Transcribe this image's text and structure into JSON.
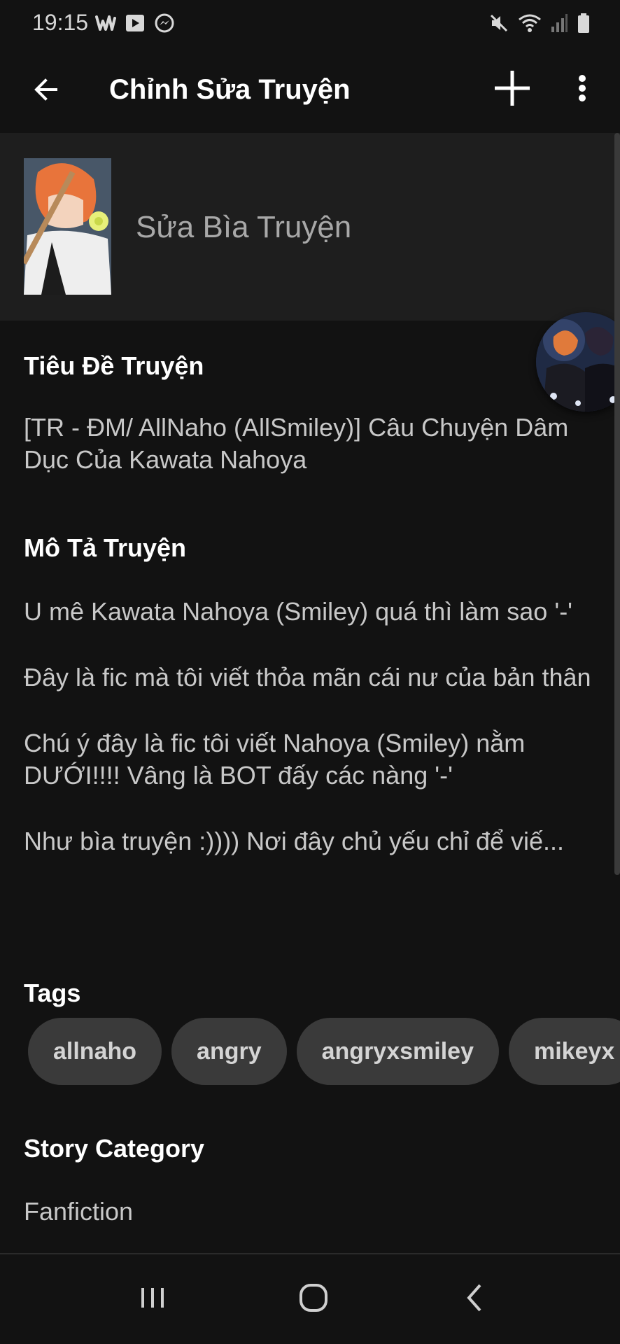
{
  "status_bar": {
    "time": "19:15",
    "icons_left": [
      "wattpad-icon",
      "youtube-icon",
      "messenger-icon"
    ],
    "icons_right": [
      "mute-icon",
      "wifi-icon",
      "signal-icon",
      "battery-icon"
    ]
  },
  "toolbar": {
    "title": "Chỉnh Sửa Truyện",
    "back_icon": "arrow-left-icon",
    "add_icon": "plus-icon",
    "more_icon": "more-vertical-icon"
  },
  "cover": {
    "label": "Sửa Bìa Truyện"
  },
  "title_section": {
    "heading": "Tiêu Đề Truyện",
    "value": "[TR - ĐM/ AllNaho (AllSmiley)] Câu Chuyện Dâm Dục Của Kawata Nahoya"
  },
  "description_section": {
    "heading": "Mô Tả Truyện",
    "paragraphs": [
      "U mê Kawata Nahoya (Smiley) quá thì làm sao '-'",
      "Đây là fic mà tôi viết thỏa mãn cái nư của bản thân",
      "Chú ý đây là fic tôi viết Nahoya (Smiley) nằm DƯỚI!!!! Vâng là BOT đấy các nàng '-'",
      "Như bìa truyện :)))) Nơi đây chủ yếu chỉ để viế..."
    ]
  },
  "tags_section": {
    "heading": "Tags",
    "tags": [
      "allnaho",
      "angry",
      "angryxsmiley",
      "mikeyx"
    ]
  },
  "category_section": {
    "heading": "Story Category",
    "value": "Fanfiction"
  },
  "nav_bar": {
    "recent_icon": "recent-apps-icon",
    "home_icon": "home-icon",
    "back_icon": "chevron-left-icon"
  },
  "colors": {
    "background": "#121212",
    "cover_row": "#1e1e1e",
    "tag_bg": "#3a3a3a",
    "text_primary": "#ffffff",
    "text_secondary": "#c8c8c8"
  }
}
